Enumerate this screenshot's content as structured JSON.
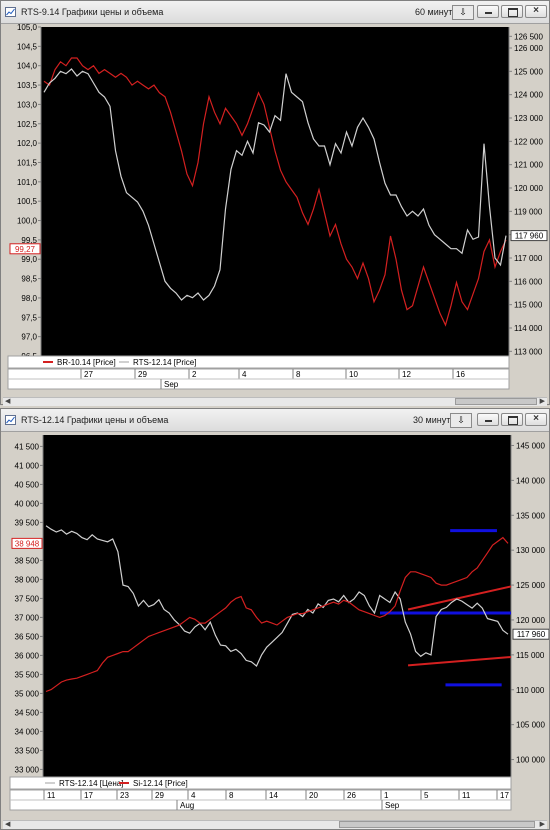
{
  "windows": [
    {
      "title": "RTS-9.14 Графики цены и объема",
      "timeframe": "60 минут",
      "timeframe_button": "⇩"
    },
    {
      "title": "RTS-12.14 Графики цены и объема",
      "timeframe": "30 минут",
      "timeframe_button": "⇩"
    }
  ],
  "chart_data": [
    {
      "type": "line",
      "background": "#000000",
      "left_axis": {
        "ticks": [
          "105,0",
          "104,5",
          "104,0",
          "103,5",
          "103,0",
          "102,5",
          "102,0",
          "101,5",
          "101,0",
          "100,5",
          "100,0",
          "99,5",
          "99,0",
          "98,5",
          "98,0",
          "97,5",
          "97,0",
          "96,5"
        ],
        "ylim": [
          96.5,
          105.0
        ],
        "current_label": "99,27",
        "current_value": 99.27,
        "current_color": "#d42020"
      },
      "right_axis": {
        "ticks": [
          "126 500",
          "126 000",
          "125 000",
          "124 000",
          "123 000",
          "122 000",
          "121 000",
          "120 000",
          "119 000",
          "118 000",
          "117 000",
          "116 000",
          "115 000",
          "114 000",
          "113 000"
        ],
        "ylim": [
          112800,
          126900
        ],
        "current_label": "117 960",
        "current_value": 117960
      },
      "x_ticks": [
        "27",
        "29",
        "2",
        "4",
        "8",
        "10",
        "12",
        "16"
      ],
      "x_month": "Sep",
      "legend": [
        {
          "label": "BR-10.14 [Price]",
          "color": "#d42020"
        },
        {
          "label": "RTS-12.14 [Price]",
          "color": "#d0d0d0"
        }
      ],
      "series": [
        {
          "name": "BR-10.14 [Price]",
          "axis": "left",
          "color": "#d42020",
          "values": [
            103.6,
            103.5,
            103.9,
            104.1,
            104.0,
            104.2,
            104.2,
            104.0,
            103.9,
            104.0,
            103.8,
            103.9,
            103.8,
            103.7,
            103.8,
            103.7,
            103.5,
            103.6,
            103.5,
            103.4,
            103.5,
            103.3,
            103.2,
            102.8,
            102.3,
            101.8,
            101.2,
            100.9,
            101.5,
            102.5,
            103.2,
            102.8,
            102.5,
            102.9,
            102.7,
            102.5,
            102.2,
            102.5,
            102.9,
            103.3,
            103.0,
            102.4,
            101.8,
            101.3,
            101.0,
            100.8,
            100.6,
            100.2,
            99.9,
            100.3,
            100.8,
            100.2,
            99.6,
            99.9,
            99.4,
            99.0,
            98.8,
            98.5,
            98.9,
            98.5,
            97.9,
            98.2,
            98.6,
            99.6,
            99.0,
            98.2,
            97.7,
            97.8,
            98.3,
            98.8,
            98.4,
            98.0,
            97.6,
            97.3,
            97.8,
            98.4,
            97.9,
            97.7,
            98.1,
            98.5,
            99.2,
            99.5,
            98.8,
            99.2,
            99.5
          ]
        },
        {
          "name": "RTS-12.14 [Price]",
          "axis": "right",
          "color": "#d0d0d0",
          "values": [
            124100,
            124500,
            124700,
            125000,
            124900,
            125100,
            124800,
            125000,
            124900,
            124500,
            124100,
            123900,
            123500,
            121600,
            120500,
            119800,
            119600,
            119400,
            119000,
            118400,
            117600,
            116800,
            116000,
            115700,
            115500,
            115200,
            115400,
            115300,
            115500,
            115200,
            115400,
            115800,
            116500,
            119100,
            120800,
            121600,
            121400,
            122000,
            121500,
            122800,
            122700,
            122400,
            123100,
            122900,
            124900,
            124100,
            123900,
            123700,
            122800,
            122100,
            121800,
            121800,
            121000,
            121900,
            121500,
            122400,
            121800,
            122600,
            123000,
            122600,
            122100,
            121100,
            120200,
            119700,
            119700,
            119200,
            118800,
            119000,
            118800,
            119100,
            118400,
            118000,
            117800,
            117600,
            117400,
            117400,
            117200,
            118200,
            117800,
            117900,
            121900,
            119200,
            117000,
            116700,
            117960
          ]
        }
      ]
    },
    {
      "type": "line",
      "background": "#000000",
      "left_axis": {
        "ticks": [
          "41 500",
          "41 000",
          "40 500",
          "40 000",
          "39 500",
          "39 000",
          "38 500",
          "38 000",
          "37 500",
          "37 000",
          "36 500",
          "36 000",
          "35 500",
          "35 000",
          "34 500",
          "34 000",
          "33 500",
          "33 000"
        ],
        "ylim": [
          32800,
          41800
        ],
        "current_label": "38 948",
        "current_value": 38948,
        "current_color": "#d42020"
      },
      "right_axis": {
        "ticks": [
          "145 000",
          "140 000",
          "135 000",
          "130 000",
          "125 000",
          "120 000",
          "115 000",
          "110 000",
          "105 000",
          "100 000"
        ],
        "ylim": [
          97500,
          146500
        ],
        "current_label": "117 960",
        "current_value": 117960
      },
      "x_ticks": [
        "11",
        "17",
        "23",
        "29",
        "4",
        "8",
        "14",
        "20",
        "26",
        "1",
        "5",
        "11",
        "17"
      ],
      "x_months": [
        "Aug",
        "Sep"
      ],
      "legend": [
        {
          "label": "RTS-12.14 [Цена]",
          "color": "#d0d0d0"
        },
        {
          "label": "Si-12.14 [Price]",
          "color": "#d42020"
        }
      ],
      "series": [
        {
          "name": "RTS-12.14 [Цена]",
          "axis": "right",
          "color": "#d0d0d0",
          "values": [
            133500,
            133000,
            132600,
            132900,
            132300,
            132700,
            132400,
            131800,
            131500,
            132200,
            131600,
            131400,
            131200,
            131600,
            129800,
            125000,
            124800,
            123800,
            122000,
            122800,
            121900,
            122200,
            122900,
            121500,
            121000,
            120000,
            119300,
            118400,
            118100,
            119000,
            119500,
            118600,
            119700,
            117800,
            116400,
            116300,
            115500,
            115800,
            115200,
            114200,
            114000,
            113400,
            115000,
            116100,
            116800,
            117500,
            118200,
            119500,
            120800,
            121000,
            120500,
            121500,
            121000,
            122300,
            121800,
            122800,
            123000,
            122600,
            123500,
            122500,
            123000,
            124000,
            123500,
            122000,
            121000,
            123500,
            123000,
            122500,
            124000,
            123000,
            119700,
            118000,
            115500,
            114800,
            115300,
            115000,
            120500,
            121500,
            121800,
            122500,
            123000,
            122700,
            122200,
            121700,
            122400,
            121700,
            120200,
            120000,
            119800,
            118500,
            117960
          ]
        },
        {
          "name": "Si-12.14 [Price]",
          "axis": "left",
          "color": "#d42020",
          "values": [
            35050,
            35100,
            35200,
            35300,
            35350,
            35380,
            35400,
            35450,
            35500,
            35550,
            35600,
            35800,
            35950,
            36000,
            36050,
            36100,
            36100,
            36200,
            36300,
            36400,
            36500,
            36550,
            36600,
            36650,
            36700,
            36750,
            36800,
            36900,
            37000,
            36950,
            36850,
            36850,
            36950,
            37050,
            37150,
            37250,
            37400,
            37500,
            37550,
            37250,
            37200,
            37000,
            36850,
            36900,
            36850,
            36800,
            36900,
            37000,
            37050,
            37100,
            37100,
            37150,
            37200,
            37250,
            37300,
            37350,
            37400,
            37350,
            37450,
            37400,
            37300,
            37200,
            37150,
            37100,
            37050,
            37000,
            37050,
            37150,
            37300,
            37700,
            38050,
            38200,
            38200,
            38150,
            38100,
            38050,
            37900,
            37850,
            37850,
            37900,
            37950,
            38000,
            38050,
            38200,
            38300,
            38500,
            38700,
            38900,
            39000,
            39100,
            38948
          ]
        }
      ],
      "annotations": [
        {
          "type": "band",
          "color": "#d42020",
          "x_range": [
            0.78,
            1.0
          ],
          "y_start": [
            121500,
            113500
          ],
          "y_end": [
            124800,
            114700
          ],
          "axis": "right"
        },
        {
          "type": "hline",
          "color": "#1010e0",
          "value": 121000,
          "x_range": [
            0.72,
            1.0
          ],
          "axis": "right"
        },
        {
          "type": "hline",
          "color": "#1010e0",
          "value": 132800,
          "x_range": [
            0.87,
            0.97
          ],
          "axis": "right"
        },
        {
          "type": "hline",
          "color": "#1010e0",
          "value": 110700,
          "x_range": [
            0.86,
            0.98
          ],
          "axis": "right"
        }
      ]
    }
  ]
}
